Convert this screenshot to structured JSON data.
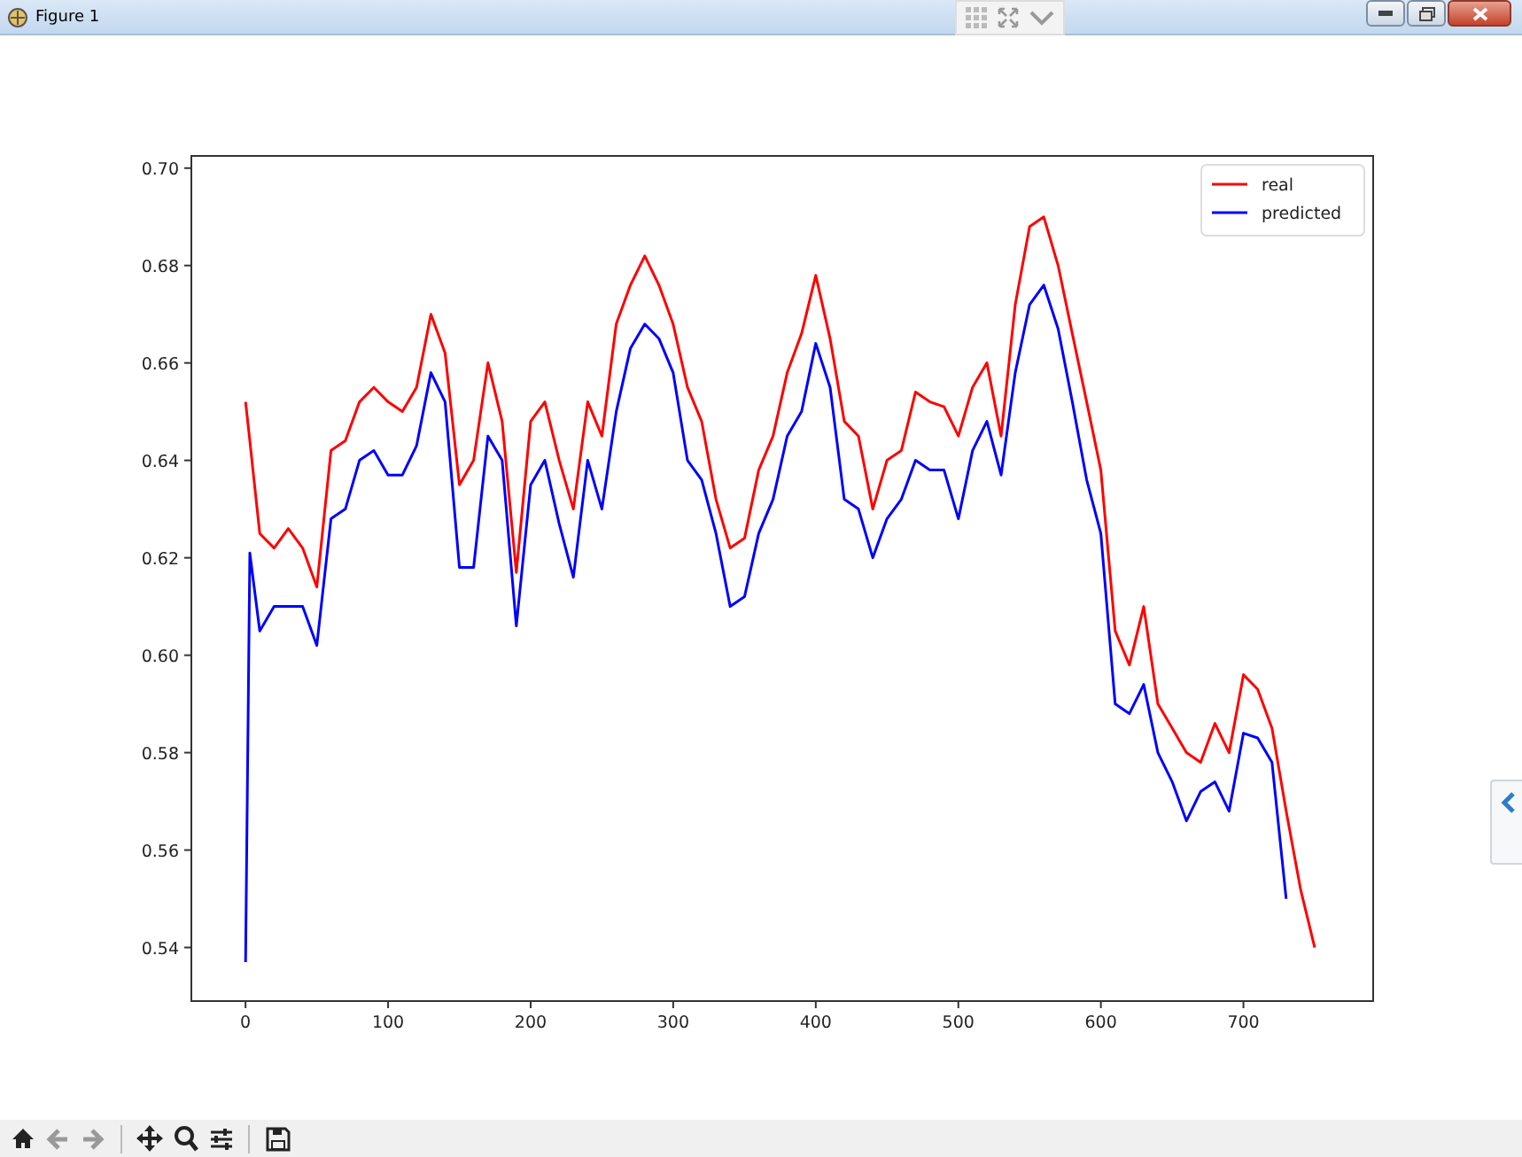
{
  "window": {
    "title": "Figure 1"
  },
  "figure": {
    "chart_data": {
      "type": "line",
      "x": [
        0,
        3,
        10,
        20,
        30,
        40,
        50,
        60,
        70,
        80,
        90,
        100,
        110,
        120,
        130,
        140,
        150,
        160,
        170,
        180,
        190,
        200,
        210,
        220,
        230,
        240,
        250,
        260,
        270,
        280,
        290,
        300,
        310,
        320,
        330,
        340,
        350,
        360,
        370,
        380,
        390,
        400,
        410,
        420,
        430,
        440,
        450,
        460,
        470,
        480,
        490,
        500,
        510,
        520,
        530,
        540,
        550,
        560,
        570,
        580,
        590,
        600,
        610,
        620,
        630,
        640,
        650,
        660,
        670,
        680,
        690,
        700,
        710,
        720,
        730,
        740,
        750
      ],
      "series": [
        {
          "name": "real",
          "color": "#ff0000",
          "values": [
            0.652,
            0.644,
            0.625,
            0.622,
            0.626,
            0.622,
            0.614,
            0.642,
            0.644,
            0.652,
            0.655,
            0.652,
            0.65,
            0.655,
            0.67,
            0.662,
            0.635,
            0.64,
            0.66,
            0.648,
            0.617,
            0.648,
            0.652,
            0.64,
            0.63,
            0.652,
            0.645,
            0.668,
            0.676,
            0.682,
            0.676,
            0.668,
            0.655,
            0.648,
            0.632,
            0.622,
            0.624,
            0.638,
            0.645,
            0.658,
            0.666,
            0.678,
            0.665,
            0.648,
            0.645,
            0.63,
            0.64,
            0.642,
            0.654,
            0.652,
            0.651,
            0.645,
            0.655,
            0.66,
            0.645,
            0.672,
            0.688,
            0.69,
            0.68,
            0.666,
            0.652,
            0.638,
            0.605,
            0.598,
            0.61,
            0.59,
            0.585,
            0.58,
            0.578,
            0.586,
            0.58,
            0.596,
            0.593,
            0.585,
            0.568,
            0.552,
            0.54
          ]
        },
        {
          "name": "predicted",
          "color": "#0000ff",
          "values": [
            0.537,
            0.621,
            0.605,
            0.61,
            0.61,
            0.61,
            0.602,
            0.628,
            0.63,
            0.64,
            0.642,
            0.637,
            0.637,
            0.643,
            0.658,
            0.652,
            0.618,
            0.618,
            0.645,
            0.64,
            0.606,
            0.635,
            0.64,
            0.627,
            0.616,
            0.64,
            0.63,
            0.65,
            0.663,
            0.668,
            0.665,
            0.658,
            0.64,
            0.636,
            0.625,
            0.61,
            0.612,
            0.625,
            0.632,
            0.645,
            0.65,
            0.664,
            0.655,
            0.632,
            0.63,
            0.62,
            0.628,
            0.632,
            0.64,
            0.638,
            0.638,
            0.628,
            0.642,
            0.648,
            0.637,
            0.658,
            0.672,
            0.676,
            0.667,
            0.652,
            0.636,
            0.625,
            0.59,
            0.588,
            0.594,
            0.58,
            0.574,
            0.566,
            0.572,
            0.574,
            0.568,
            0.584,
            0.583,
            0.578,
            0.55,
            null,
            null
          ]
        }
      ],
      "legend": true,
      "xlim": [
        -38,
        791
      ],
      "ylim": [
        0.529,
        0.7025
      ],
      "xticks": [
        0,
        100,
        200,
        300,
        400,
        500,
        600,
        700
      ],
      "yticks": [
        {
          "value": 0.54,
          "label": "0.54"
        },
        {
          "value": 0.56,
          "label": "0.56"
        },
        {
          "value": 0.58,
          "label": "0.58"
        },
        {
          "value": 0.6,
          "label": "0.60"
        },
        {
          "value": 0.62,
          "label": "0.62"
        },
        {
          "value": 0.64,
          "label": "0.64"
        },
        {
          "value": 0.66,
          "label": "0.66"
        },
        {
          "value": 0.68,
          "label": "0.68"
        },
        {
          "value": 0.7,
          "label": "0.70"
        }
      ]
    }
  }
}
